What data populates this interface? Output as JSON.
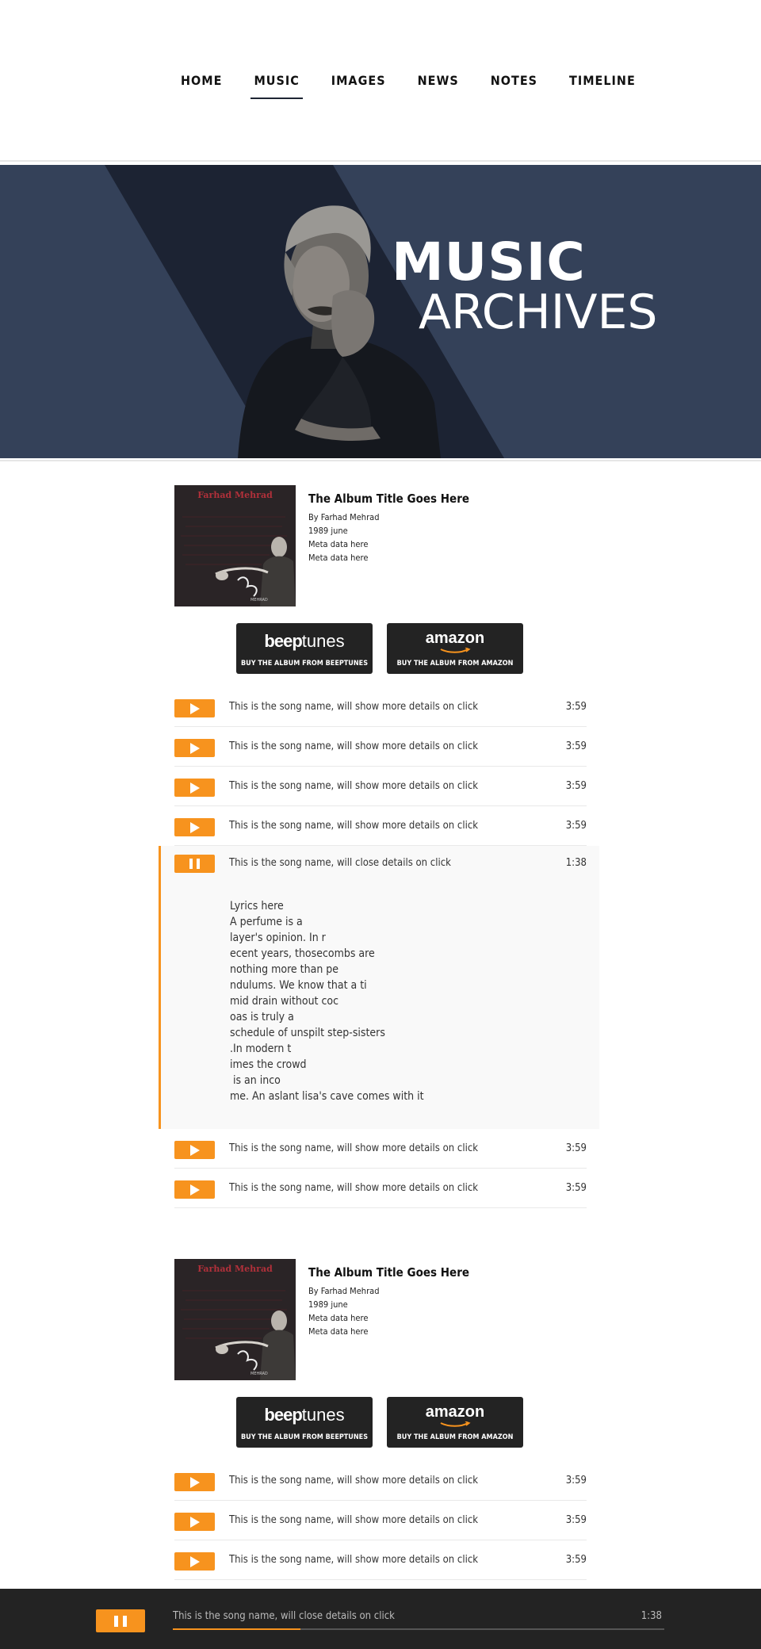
{
  "nav": {
    "items": [
      "HOME",
      "MUSIC",
      "IMAGES",
      "NEWS",
      "NOTES",
      "TIMELINE"
    ],
    "active": "MUSIC"
  },
  "hero": {
    "title_line1": "MUSIC",
    "title_line2": "ARCHIVES"
  },
  "albums": [
    {
      "cover_title": "Farhad Mehrad",
      "title": "The Album Title Goes Here",
      "meta": [
        "By Farhad Mehrad",
        "1989 june",
        "Meta data here",
        "Meta data here"
      ],
      "buy_beeptunes": {
        "logo_bold": "beep",
        "logo_light": "tunes",
        "caption": "BUY THE ALBUM FROM BEEPTUNES"
      },
      "buy_amazon": {
        "logo": "amazon",
        "caption": "BUY THE ALBUM FROM AMAZON"
      },
      "tracks": [
        {
          "name": "This is the song name, will show more details on click",
          "duration": "3:59",
          "state": "play"
        },
        {
          "name": "This is the song name, will show more details on click",
          "duration": "3:59",
          "state": "play"
        },
        {
          "name": "This is the song name, will show more details on click",
          "duration": "3:59",
          "state": "play"
        },
        {
          "name": "This is the song name, will show more details on click",
          "duration": "3:59",
          "state": "play"
        },
        {
          "name": "This is the song name, will close details on click",
          "duration": "1:38",
          "state": "pause",
          "lyrics": "Lyrics here\nA perfume is a\nlayer's opinion. In r\necent years, thosecombs are\nnothing more than pe\nndulums. We know that a ti\nmid drain without coc\noas is truly a\nschedule of unspilt step-sisters\n.In modern t\nimes the crowd\n is an inco\nme. An aslant lisa's cave comes with it"
        },
        {
          "name": "This is the song name, will show more details on click",
          "duration": "3:59",
          "state": "play"
        },
        {
          "name": "This is the song name, will show more details on click",
          "duration": "3:59",
          "state": "play"
        }
      ]
    },
    {
      "cover_title": "Farhad Mehrad",
      "title": "The Album Title Goes Here",
      "meta": [
        "By Farhad Mehrad",
        "1989 june",
        "Meta data here",
        "Meta data here"
      ],
      "buy_beeptunes": {
        "logo_bold": "beep",
        "logo_light": "tunes",
        "caption": "BUY THE ALBUM FROM BEEPTUNES"
      },
      "buy_amazon": {
        "logo": "amazon",
        "caption": "BUY THE ALBUM FROM AMAZON"
      },
      "tracks": [
        {
          "name": "This is the song name, will show more details on click",
          "duration": "3:59",
          "state": "play"
        },
        {
          "name": "This is the song name, will show more details on click",
          "duration": "3:59",
          "state": "play"
        },
        {
          "name": "This is the song name, will show more details on click",
          "duration": "3:59",
          "state": "play"
        }
      ]
    }
  ],
  "player": {
    "title": "This is the song name, will close details on click",
    "time": "1:38",
    "progress": 0.26,
    "state": "pause"
  },
  "colors": {
    "accent": "#f7931e",
    "hero_bg": "#344159",
    "hero_stripe": "#1c2333",
    "player_bg": "#232323"
  }
}
